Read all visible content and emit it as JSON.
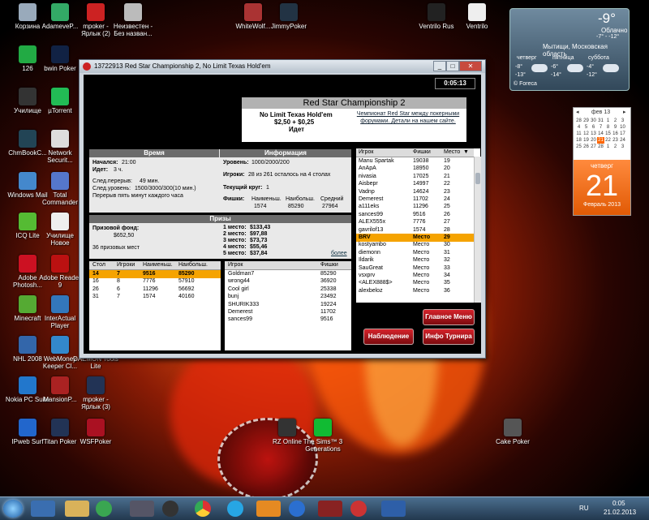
{
  "desktop_icons": [
    {
      "label": "Корзина",
      "color": "#9ab"
    },
    {
      "label": "AdameveP...",
      "color": "#3a6"
    },
    {
      "label": "mpoker - Ярлык (2)",
      "color": "#c22"
    },
    {
      "label": "Неизвестен - Без назван...",
      "color": "#bbb"
    },
    {
      "label": "WhiteWolf...",
      "color": "#a33"
    },
    {
      "label": "JimmyPoker",
      "color": "#234"
    },
    {
      "label": "Ventrilo Rus",
      "color": "#222"
    },
    {
      "label": "Ventrilo",
      "color": "#eee"
    },
    {
      "label": "126",
      "color": "#2a4"
    },
    {
      "label": "bwin Poker",
      "color": "#124"
    },
    {
      "label": "Училище",
      "color": "#333"
    },
    {
      "label": "µTorrent",
      "color": "#2b5"
    },
    {
      "label": "ChmBookC...",
      "color": "#245"
    },
    {
      "label": "Network Securit...",
      "color": "#ddd"
    },
    {
      "label": "Windows Mail",
      "color": "#48c"
    },
    {
      "label": "Total Commander",
      "color": "#57c"
    },
    {
      "label": "ICQ Lite",
      "color": "#5b3"
    },
    {
      "label": "Училище Новое",
      "color": "#eee"
    },
    {
      "label": "Adobe Photosh...",
      "color": "#c12"
    },
    {
      "label": "Adobe Reader 9",
      "color": "#b11"
    },
    {
      "label": "Minecraft",
      "color": "#5a3"
    },
    {
      "label": "InterActual Player",
      "color": "#37b"
    },
    {
      "label": "NHL 2008",
      "color": "#36a"
    },
    {
      "label": "WebMoney Keeper Cl...",
      "color": "#38c"
    },
    {
      "label": "DAEMON Tools Lite",
      "color": "#444"
    },
    {
      "label": "Nokia PC Suite",
      "color": "#27c"
    },
    {
      "label": "MansionP...",
      "color": "#a22"
    },
    {
      "label": "mpoker - Ярлык (3)",
      "color": "#235"
    },
    {
      "label": "IPweb Surf",
      "color": "#26c"
    },
    {
      "label": "Titan Poker",
      "color": "#235"
    },
    {
      "label": "WSFPoker",
      "color": "#a12"
    },
    {
      "label": "RZ Online",
      "color": "#333"
    },
    {
      "label": "The Sims™ 3 Generations",
      "color": "#1b3"
    },
    {
      "label": "Cake Poker",
      "color": "#555"
    }
  ],
  "weather": {
    "temp": "-9°",
    "condition": "Облачно",
    "range": "-7° - -12°",
    "location": "Мытищи, Московская область",
    "days": [
      {
        "name": "четверг",
        "hi": "-8°",
        "lo": "-13°"
      },
      {
        "name": "пятница",
        "hi": "-6°",
        "lo": "-14°"
      },
      {
        "name": "суббота",
        "hi": "-4°",
        "lo": "-12°"
      }
    ],
    "source": "© Foreca"
  },
  "calendar": {
    "month": "фев 13",
    "prev": "◂",
    "next": "▸",
    "rows": [
      [
        "28",
        "29",
        "30",
        "31",
        "1",
        "2",
        "3"
      ],
      [
        "4",
        "5",
        "6",
        "7",
        "8",
        "9",
        "10"
      ],
      [
        "11",
        "12",
        "13",
        "14",
        "15",
        "16",
        "17"
      ],
      [
        "18",
        "19",
        "20",
        "21",
        "22",
        "23",
        "24"
      ],
      [
        "25",
        "26",
        "27",
        "28",
        "1",
        "2",
        "3"
      ]
    ],
    "today": "21",
    "weekday": "четверг",
    "day": "21",
    "month_year": "Февраль 2013"
  },
  "window": {
    "title": "13722913 Red Star Championship 2, No Limit Texas Hold'em",
    "btn_min": "_",
    "btn_max": "□",
    "btn_close": "✕",
    "timer": "0:05:13"
  },
  "header": {
    "title": "Red Star Championship 2",
    "game": "No Limit Texas Hold'em",
    "stakes": "$2,50 + $0,25",
    "status": "Идет",
    "link": "Чемпионат Red Star между покерными форумами. Детали на нашем сайте."
  },
  "time_panel": {
    "heading": "Время",
    "started_label": "Начался:",
    "started": "21:00",
    "running_label": "Идет:",
    "running": "3 ч.",
    "next_break_label": "След.перерыв:",
    "next_break": "49 мин.",
    "next_level_label": "След.уровень:",
    "next_level": "1500/3000/300(10 мин.)",
    "break_note": "Перерыв пять минут каждого часа"
  },
  "info_panel": {
    "heading": "Информация",
    "level_label": "Уровень:",
    "level": "1000/2000/200",
    "players_label": "Игроки:",
    "players": "28 из 261 осталось на 4 столах",
    "round_label": "Текущий круг:",
    "round": "1",
    "chips_label": "Фишки:",
    "smallest_label": "Наименьш.",
    "largest_label": "Наибольш.",
    "average_label": "Средний",
    "smallest": "1574",
    "largest": "85290",
    "average": "27964"
  },
  "prizes_panel": {
    "heading": "Призы",
    "pool_label": "Призовой фонд:",
    "pool": "$652,50",
    "paid": "36 призовых мест",
    "more": "более",
    "places": [
      {
        "label": "1 место:",
        "amount": "$133,43"
      },
      {
        "label": "2 место:",
        "amount": "$97,88"
      },
      {
        "label": "3 место:",
        "amount": "$73,73"
      },
      {
        "label": "4 место:",
        "amount": "$55,46"
      },
      {
        "label": "5 место:",
        "amount": "$37,84"
      }
    ]
  },
  "tables_list": {
    "headers": [
      "Стол",
      "Игроки",
      "Наименьш.",
      "Наибольш."
    ],
    "rows": [
      [
        "14",
        "7",
        "9516",
        "85290"
      ],
      [
        "16",
        "8",
        "7776",
        "57910"
      ],
      [
        "26",
        "6",
        "11296",
        "56692"
      ],
      [
        "31",
        "7",
        "1574",
        "40160"
      ]
    ]
  },
  "table_players": {
    "headers": [
      "Игрок",
      "Фишки"
    ],
    "rows": [
      [
        "Goldman7",
        "85290"
      ],
      [
        "wrong44",
        "36920"
      ],
      [
        "Cool girl",
        "25338"
      ],
      [
        "bunj",
        "23492"
      ],
      [
        "SHURIK333",
        "19224"
      ],
      [
        "Demerest",
        "11702"
      ],
      [
        "sances99",
        "9516"
      ]
    ]
  },
  "players_list": {
    "headers": [
      "Игрок",
      "Фишки",
      "Место"
    ],
    "sort_arrow": "▼",
    "rows": [
      [
        "Manu Spartak",
        "19038",
        "19"
      ],
      [
        "AnApA",
        "18950",
        "20"
      ],
      [
        "nivasia",
        "17025",
        "21"
      ],
      [
        "Aisbepr",
        "14997",
        "22"
      ],
      [
        "Vadnp",
        "14624",
        "23"
      ],
      [
        "Demerest",
        "11702",
        "24"
      ],
      [
        "a111eks",
        "11296",
        "25"
      ],
      [
        "sances99",
        "9516",
        "26"
      ],
      [
        "ALEX555x",
        "7776",
        "27"
      ],
      [
        "gavrilof13",
        "1574",
        "28"
      ],
      [
        "BRV",
        "Место",
        "29"
      ],
      [
        "kostyambo",
        "Место",
        "30"
      ],
      [
        "diemonn",
        "Место",
        "31"
      ],
      [
        "Ildarik",
        "Место",
        "32"
      ],
      [
        "SauGreat",
        "Место",
        "33"
      ],
      [
        "vsxprv",
        "Место",
        "34"
      ],
      [
        "<ALEX888$>",
        "Место",
        "35"
      ],
      [
        "alexbeloz",
        "Место",
        "36"
      ]
    ]
  },
  "buttons": {
    "main_menu": "Главное Меню",
    "watch": "Наблюдение",
    "info": "Инфо Турнира"
  },
  "taskbar": {
    "lang": "RU",
    "time": "0:05",
    "date": "21.02.2013"
  }
}
